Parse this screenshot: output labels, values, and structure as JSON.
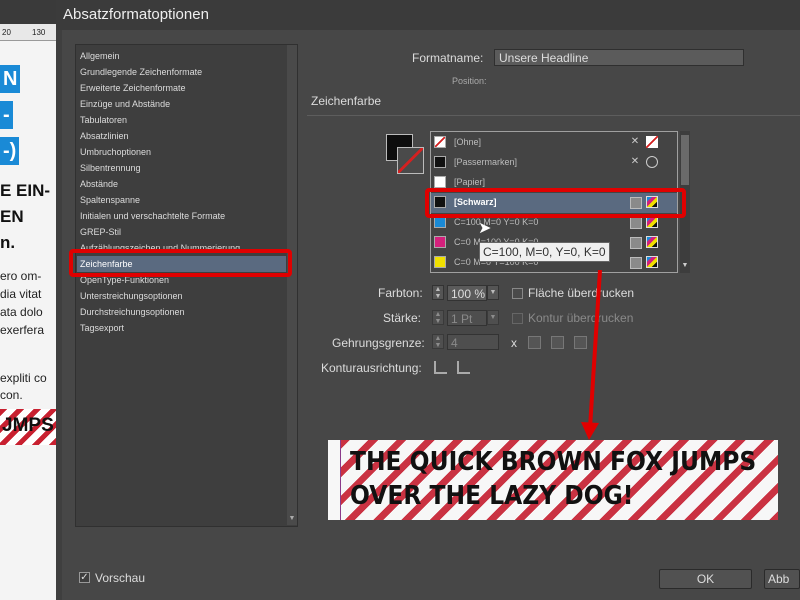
{
  "dialog": {
    "title": "Absatzformatoptionen"
  },
  "background_doc": {
    "ruler_ticks": [
      "20",
      "130"
    ],
    "headings": [
      "N",
      "-",
      "-)"
    ],
    "bold_lines": [
      "E EIN-",
      "EN",
      "n."
    ],
    "body_lines": [
      "ero om-",
      "dia vitat",
      "ata dolo",
      "exerfera",
      "expliti co",
      "con."
    ],
    "stripe_text": "JMPS"
  },
  "categories": [
    "Allgemein",
    "Grundlegende Zeichenformate",
    "Erweiterte Zeichenformate",
    "Einzüge und Abstände",
    "Tabulatoren",
    "Absatzlinien",
    "Umbruchoptionen",
    "Silbentrennung",
    "Abstände",
    "Spaltenspanne",
    "Initialen und verschachtelte Formate",
    "GREP-Stil",
    "Aufzählungszeichen und Nummerierung",
    "Zeichenfarbe",
    "OpenType-Funktionen",
    "Unterstreichungsoptionen",
    "Durchstreichungsoptionen",
    "Tagsexport"
  ],
  "selected_category": "Zeichenfarbe",
  "format": {
    "name_label": "Formatname:",
    "name_value": "Unsere Headline",
    "position_label": "Position:"
  },
  "section_title": "Zeichenfarbe",
  "swatches": [
    {
      "name": "[Ohne]",
      "color": "none",
      "icon2": "none-icon"
    },
    {
      "name": "[Passermarken]",
      "color": "#111111",
      "icon2": "registration-icon"
    },
    {
      "name": "[Papier]",
      "color": "#ffffff",
      "icon2": ""
    },
    {
      "name": "[Schwarz]",
      "color": "#111111",
      "icon2": "cmyk-icon"
    },
    {
      "name": "C=100 M=0 Y=0 K=0",
      "color": "#1a8ad6",
      "icon2": "cmyk-icon"
    },
    {
      "name": "C=0 M=100 Y=0 K=0",
      "color": "#d4207c",
      "icon2": "cmyk-icon"
    },
    {
      "name": "C=0 M=0 Y=100 K=0",
      "color": "#f0e000",
      "icon2": "cmyk-icon"
    }
  ],
  "selected_swatch": "[Schwarz]",
  "tooltip": "C=100, M=0, Y=0, K=0",
  "controls": {
    "farbton_label": "Farbton:",
    "farbton_value": "100 %",
    "flaeche_label": "Fläche überdrucken",
    "staerke_label": "Stärke:",
    "staerke_value": "1 Pt",
    "kontur_label": "Kontur überdrucken",
    "gehrung_label": "Gehrungsgrenze:",
    "gehrung_value": "4",
    "gehrung_x": "x",
    "kontur_ausrichtung_label": "Konturausrichtung:"
  },
  "preview": {
    "line1": "THE QUICK BROWN FOX JUMPS",
    "line2": "OVER THE LAZY DOG!"
  },
  "footer": {
    "vorschau_label": "Vorschau",
    "vorschau_checked": "✓",
    "ok_label": "OK",
    "cancel_label": "Abb"
  },
  "colors": {
    "accent": "#5a6a80",
    "highlight": "#e00000"
  }
}
